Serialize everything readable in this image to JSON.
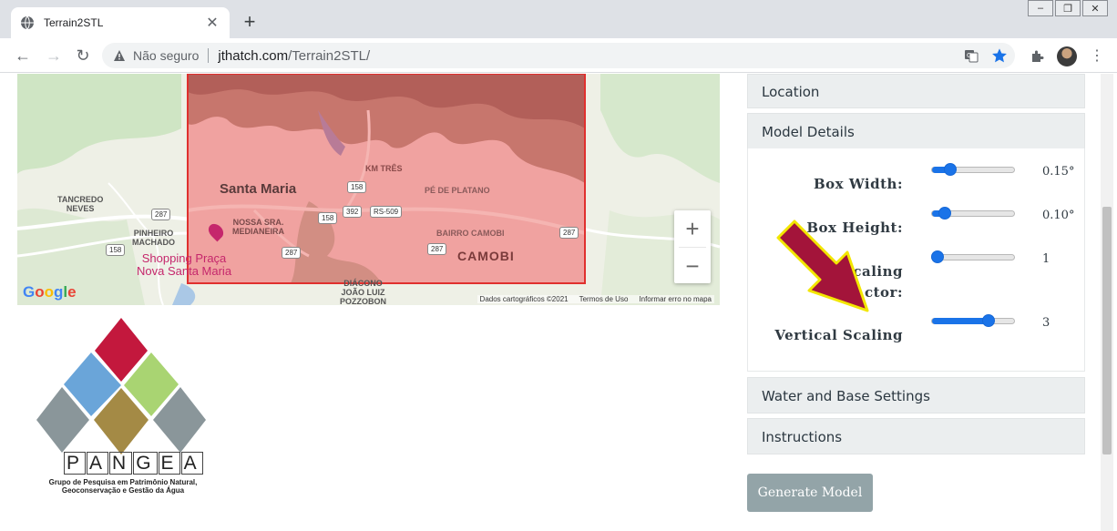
{
  "browser": {
    "tab_title": "Terrain2STL",
    "security_text": "Não seguro",
    "url_host": "jthatch.com",
    "url_path": "/Terrain2STL/"
  },
  "map": {
    "labels": {
      "santa_maria": "Santa Maria",
      "camobi": "CAMOBI",
      "bairro_camobi": "BAIRRO CAMOBI",
      "km_tres": "KM TRÊS",
      "pe_de_platano": "PÉ DE PLATANO",
      "tancredo": "TANCREDO\nNEVES",
      "pinheiro": "PINHEIRO\nMACHADO",
      "nossa_sra": "NOSSA SRA.\nMEDIANEIRA",
      "diacono": "DIÁCONO\nJOÃO LUIZ\nPOZZOBON",
      "shopping": "Shopping Praça\nNova Santa Maria"
    },
    "shields": [
      "287",
      "158",
      "287",
      "158",
      "392",
      "RS-509",
      "158",
      "287",
      "287",
      "287"
    ],
    "zoom_in": "+",
    "zoom_out": "−",
    "google": "Google",
    "attribution": [
      "Dados cartográficos ©2021",
      "Termos de Uso",
      "Informar erro no mapa"
    ]
  },
  "logo": {
    "word": [
      "P",
      "A",
      "N",
      "G",
      "E",
      "A"
    ],
    "subtitle": "Grupo de Pesquisa em Patrimônio Natural,\nGeoconservação e Gestão da Água"
  },
  "accordion": {
    "location": "Location",
    "model_details": "Model Details",
    "water_base": "Water and Base Settings",
    "instructions": "Instructions"
  },
  "model_details": {
    "box_width_label": "Box Width:",
    "box_width_value": "0.15°",
    "box_width_level": 0.18,
    "box_height_label": "Box Height:",
    "box_height_value": "0.10°",
    "box_height_level": 0.1,
    "scaling_label": "caling\nctor:",
    "scaling_value": "1",
    "scaling_level": 0.0,
    "vertical_label": "Vertical Scaling",
    "vertical_value": "3",
    "vertical_level": 0.72
  },
  "generate_label": "Generate Model",
  "colors": {
    "slider": "#1a73e8",
    "selection": "#f06c6c",
    "arrow": "#a3143a",
    "arrow_outline": "#f2e600"
  }
}
